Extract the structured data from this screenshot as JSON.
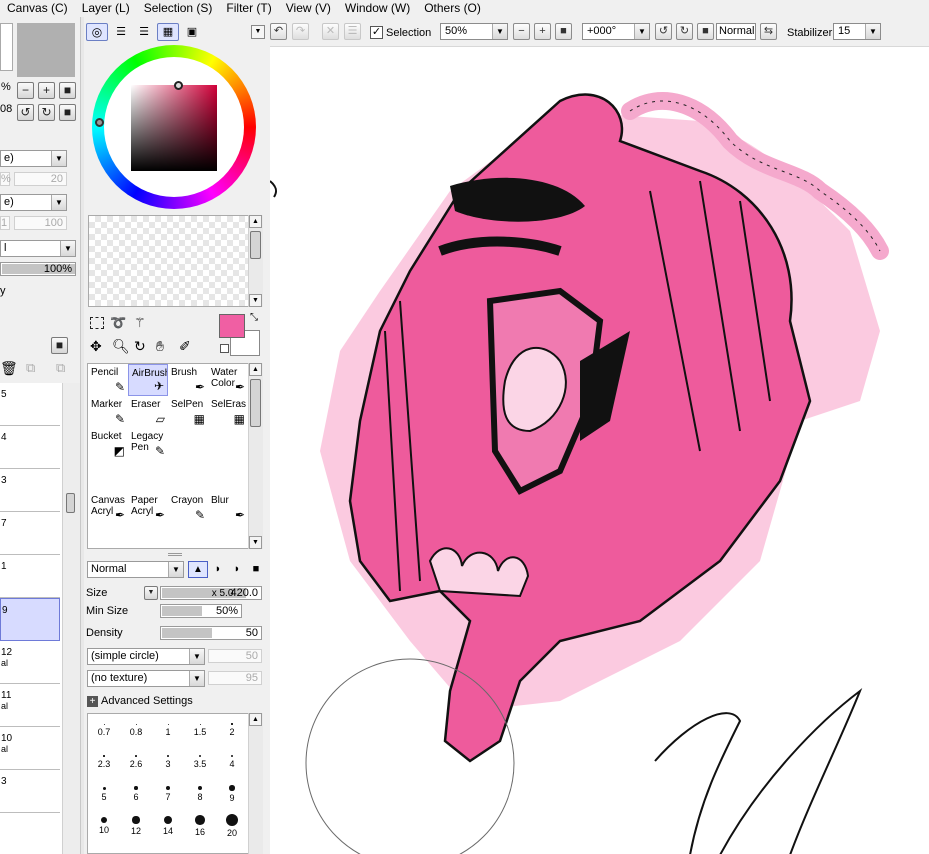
{
  "menu": [
    "Canvas (C)",
    "Layer (L)",
    "Selection (S)",
    "Filter (T)",
    "View (V)",
    "Window (W)",
    "Others (O)"
  ],
  "toolbar": {
    "selection_label": "Selection",
    "zoom_value": "50%",
    "rotation_value": "+000°",
    "blend_value": "Normal",
    "stabilizer_label": "Stabilizer",
    "stabilizer_value": "15"
  },
  "left_panel": {
    "percent_a": "%",
    "value_08": "08",
    "field_20": "20",
    "field_100": "100",
    "opacity_value": "100%",
    "dropdown_a": "e)",
    "dropdown_b": "e)",
    "dropdown_c": "l",
    "text_y": "y",
    "zero_a": "0",
    "one_a": "1"
  },
  "layers": [
    {
      "num": "5",
      "mode": ""
    },
    {
      "num": "4",
      "mode": ""
    },
    {
      "num": "3",
      "mode": ""
    },
    {
      "num": "7",
      "mode": ""
    },
    {
      "num": "1",
      "mode": ""
    },
    {
      "num": "9",
      "mode": ""
    },
    {
      "num": "12",
      "mode": "al"
    },
    {
      "num": "11",
      "mode": "al"
    },
    {
      "num": "10",
      "mode": "al"
    },
    {
      "num": "3",
      "mode": ""
    }
  ],
  "tools": [
    {
      "label": "Pencil",
      "icon": "✎"
    },
    {
      "label": "AirBrush",
      "icon": "✈"
    },
    {
      "label": "Brush",
      "icon": "✒"
    },
    {
      "label": "Water\nColor",
      "icon": "✒"
    },
    {
      "label": "Marker",
      "icon": "✎"
    },
    {
      "label": "Eraser",
      "icon": "▱"
    },
    {
      "label": "SelPen",
      "icon": "▦"
    },
    {
      "label": "SelEras",
      "icon": "▦"
    },
    {
      "label": "Bucket",
      "icon": "◩"
    },
    {
      "label": "Legacy\nPen",
      "icon": "✎"
    },
    {
      "label": "Canvas\nAcryl",
      "icon": "✒"
    },
    {
      "label": "Paper\nAcryl",
      "icon": "✒"
    },
    {
      "label": "Crayon",
      "icon": "✎"
    },
    {
      "label": "Blur",
      "icon": "✒"
    }
  ],
  "brush": {
    "blend_mode": "Normal",
    "size_label": "Size",
    "size_mult": "x 5.0",
    "size_value": "420.0",
    "size_fill": 0.84,
    "min_size_label": "Min Size",
    "min_size_value": "50%",
    "min_size_fill": 0.5,
    "density_label": "Density",
    "density_value": "50",
    "density_fill": 0.5,
    "shape": "(simple circle)",
    "shape_value": "50",
    "texture": "(no texture)",
    "texture_value": "95",
    "advanced_label": "Advanced Settings",
    "size_presets": [
      "0.7",
      "0.8",
      "1",
      "1.5",
      "2",
      "2.3",
      "2.6",
      "3",
      "3.5",
      "4",
      "5",
      "6",
      "7",
      "8",
      "9",
      "10",
      "12",
      "14",
      "16",
      "20"
    ]
  },
  "colors": {
    "primary": "#f05fa3",
    "pink_light": "#f9a8cf",
    "selection": "#d7dbff"
  }
}
